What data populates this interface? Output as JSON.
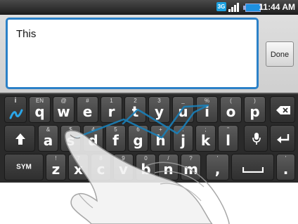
{
  "status_bar": {
    "time": "11:44 AM",
    "network_badge": "3G",
    "icons": [
      "network-3g-icon",
      "signal-icon",
      "battery-icon"
    ]
  },
  "compose": {
    "text": "This",
    "done_label": "Done"
  },
  "keyboard": {
    "row1": [
      {
        "main": "q",
        "alt": "EN"
      },
      {
        "main": "w",
        "alt": "@"
      },
      {
        "main": "e",
        "alt": "#"
      },
      {
        "main": "r",
        "alt": "1"
      },
      {
        "main": "t",
        "alt": "2"
      },
      {
        "main": "y",
        "alt": "3"
      },
      {
        "main": "u",
        "alt": "_"
      },
      {
        "main": "i",
        "alt": "%"
      },
      {
        "main": "o",
        "alt": "("
      },
      {
        "main": "p",
        "alt": ")"
      }
    ],
    "row2": [
      {
        "main": "a",
        "alt": "&"
      },
      {
        "main": "s",
        "alt": "$"
      },
      {
        "main": "d",
        "alt": "4"
      },
      {
        "main": "f",
        "alt": "5"
      },
      {
        "main": "g",
        "alt": "6"
      },
      {
        "main": "h",
        "alt": "+"
      },
      {
        "main": "j",
        "alt": ":"
      },
      {
        "main": "k",
        "alt": ";"
      },
      {
        "main": "l",
        "alt": "\""
      }
    ],
    "row3": [
      {
        "main": "z",
        "alt": "!"
      },
      {
        "main": "x",
        "alt": "7"
      },
      {
        "main": "c",
        "alt": "8"
      },
      {
        "main": "v",
        "alt": "9"
      },
      {
        "main": "b",
        "alt": "0"
      },
      {
        "main": "n",
        "alt": "/"
      },
      {
        "main": "m",
        "alt": "?"
      }
    ],
    "sym_label": "SYM",
    "info_alt": "i",
    "comma": ",",
    "period": ".",
    "comma_alt": "'",
    "period_alt": "'",
    "icons": {
      "swype": "swype-icon",
      "backspace": "backspace-icon",
      "shift": "shift-icon",
      "mic": "microphone-icon",
      "enter": "enter-icon",
      "space": "space-icon"
    },
    "trace_color": "#1a7fb8"
  }
}
